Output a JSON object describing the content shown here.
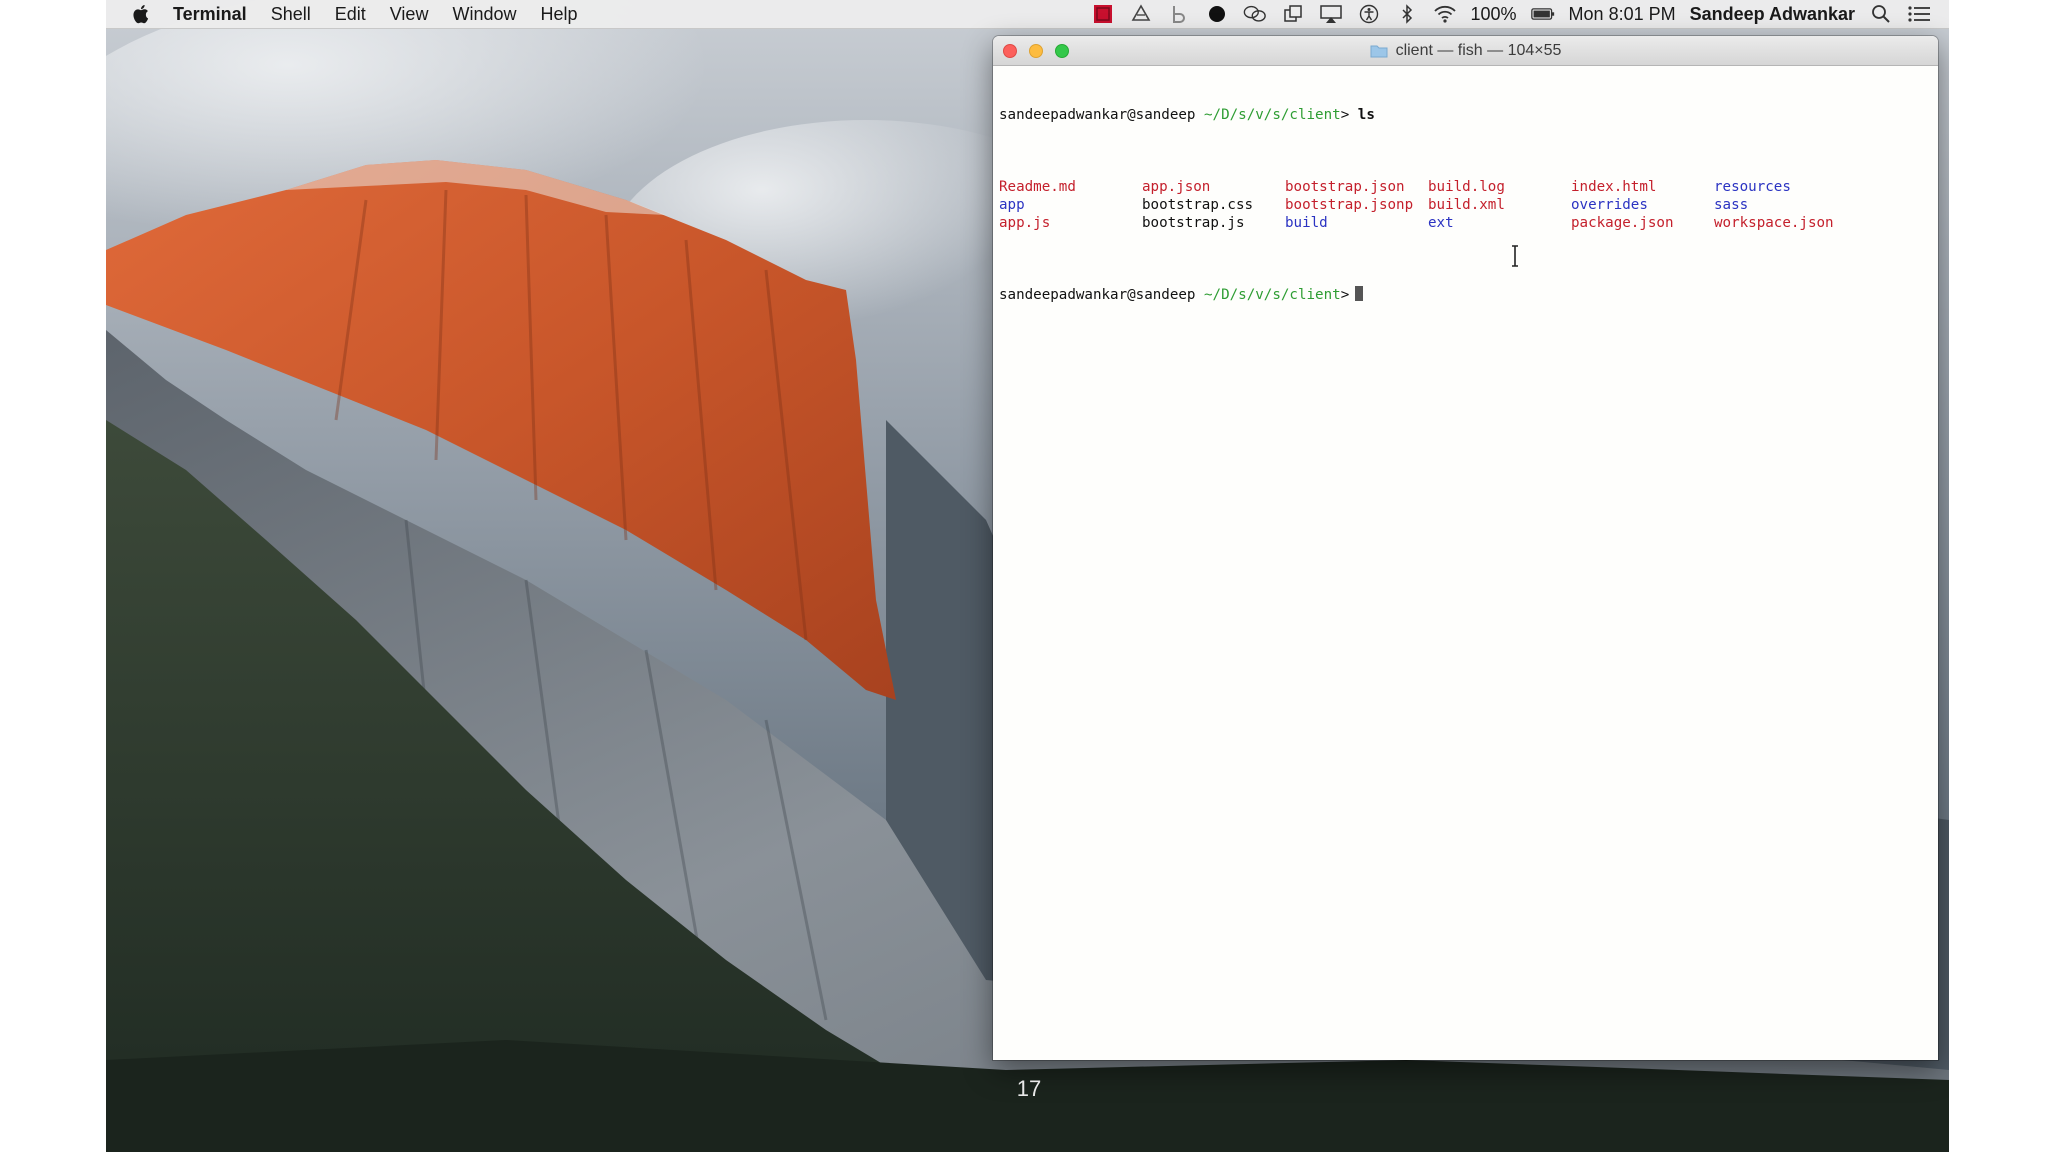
{
  "menubar": {
    "app_name": "Terminal",
    "menus": [
      "Shell",
      "Edit",
      "View",
      "Window",
      "Help"
    ],
    "battery_percent": "100%",
    "clock": "Mon 8:01 PM",
    "user": "Sandeep Adwankar",
    "tray_icons": [
      "red-app-icon",
      "drive-icon",
      "b-icon",
      "dark-circle-icon",
      "chat-bubbles-icon",
      "overlap-windows-icon",
      "airplay-icon",
      "accessibility-icon",
      "bluetooth-icon",
      "wifi-icon",
      "battery-icon",
      "spotlight-search-icon",
      "notification-list-icon"
    ]
  },
  "terminal": {
    "title": "client — fish — 104×55",
    "prompt_user": "sandeepadwankar@sandeep",
    "prompt_path": "~/D/s/v/s/client",
    "prompt_symbol": ">",
    "command": "ls",
    "ls_output": [
      [
        {
          "text": "Readme.md",
          "kind": "file"
        },
        {
          "text": "app.json",
          "kind": "file"
        },
        {
          "text": "bootstrap.json",
          "kind": "file"
        },
        {
          "text": "build.log",
          "kind": "file"
        },
        {
          "text": "index.html",
          "kind": "file"
        },
        {
          "text": "resources",
          "kind": "dir"
        }
      ],
      [
        {
          "text": "app",
          "kind": "dir"
        },
        {
          "text": "bootstrap.css",
          "kind": "plain"
        },
        {
          "text": "bootstrap.jsonp",
          "kind": "file"
        },
        {
          "text": "build.xml",
          "kind": "file"
        },
        {
          "text": "overrides",
          "kind": "dir"
        },
        {
          "text": "sass",
          "kind": "dir"
        }
      ],
      [
        {
          "text": "app.js",
          "kind": "file"
        },
        {
          "text": "bootstrap.js",
          "kind": "plain"
        },
        {
          "text": "build",
          "kind": "dir"
        },
        {
          "text": "ext",
          "kind": "dir"
        },
        {
          "text": "package.json",
          "kind": "file"
        },
        {
          "text": "workspace.json",
          "kind": "file"
        }
      ]
    ]
  },
  "colors": {
    "file": "#c4202c",
    "dir": "#2b33c2",
    "plain": "#111111",
    "prompt_path": "#2e9d33"
  },
  "slide": {
    "page_number": "17"
  }
}
